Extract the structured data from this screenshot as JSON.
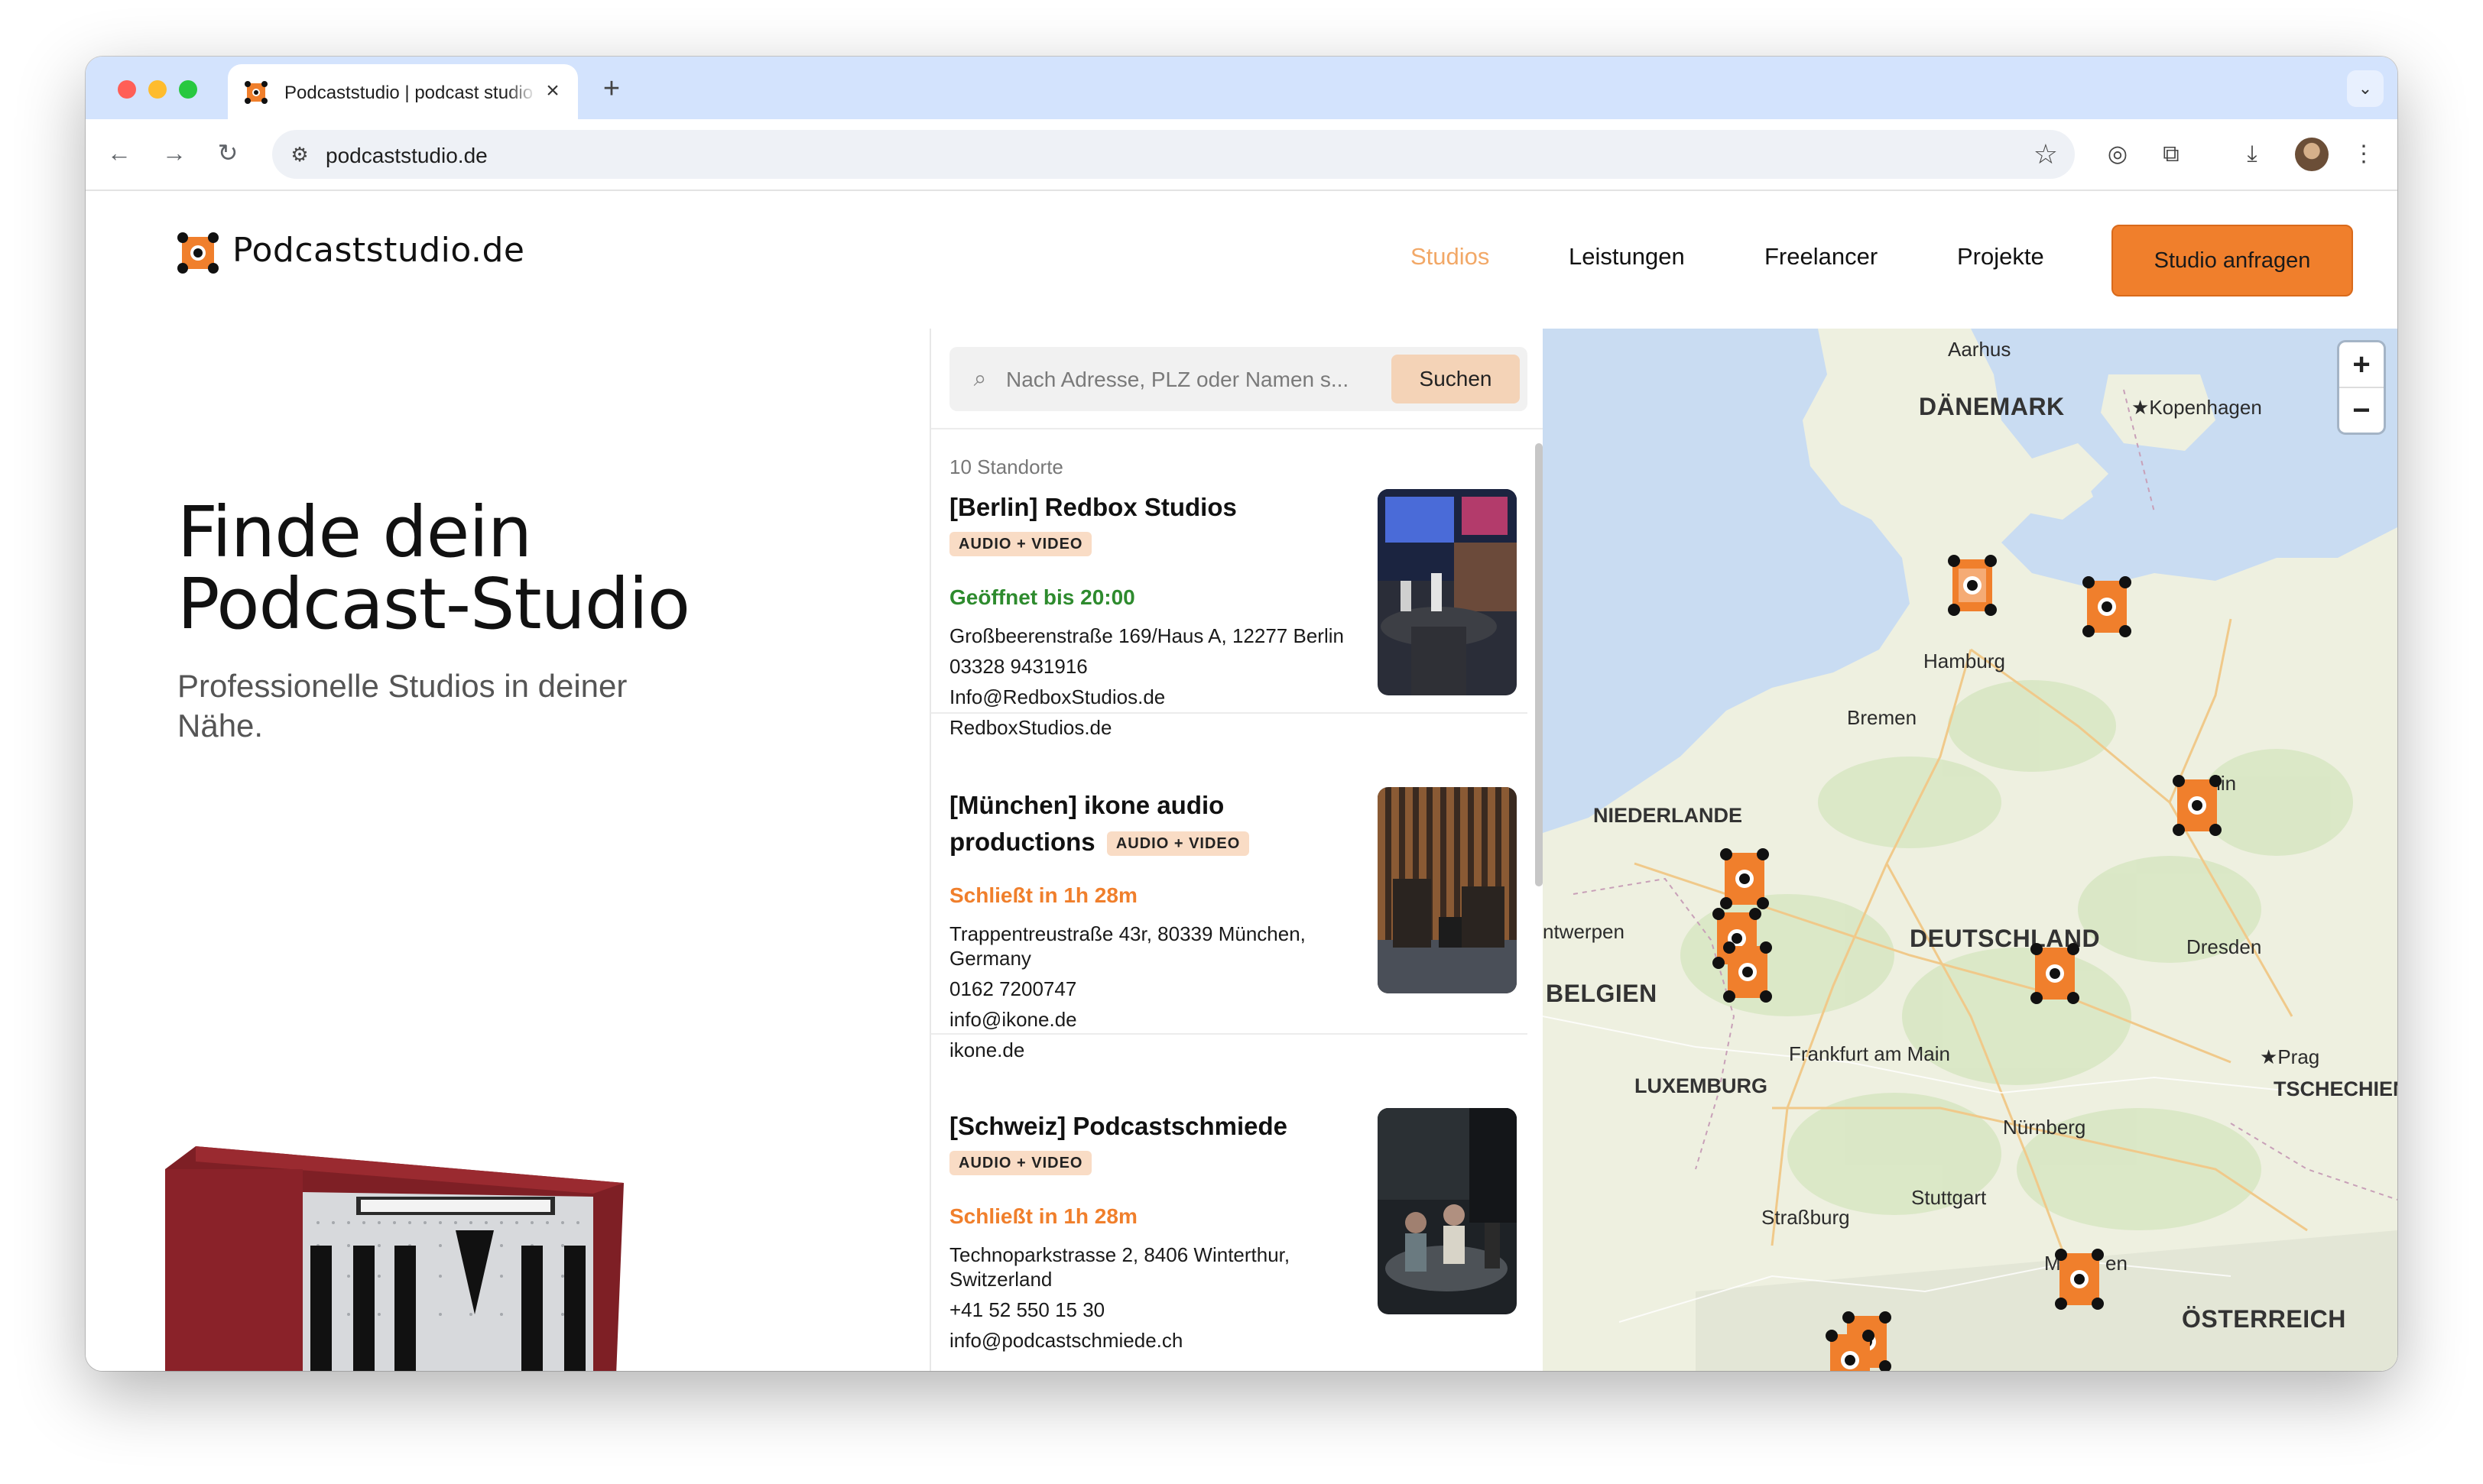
{
  "browser": {
    "tab_title": "Podcaststudio | podcast studio",
    "url": "podcaststudio.de"
  },
  "header": {
    "brand": "Podcaststudio.de",
    "nav": [
      {
        "label": "Studios",
        "active": true
      },
      {
        "label": "Leistungen"
      },
      {
        "label": "Freelancer"
      },
      {
        "label": "Projekte"
      }
    ],
    "cta": "Studio anfragen"
  },
  "hero": {
    "title_line1": "Finde dein",
    "title_line2": "Podcast-Studio",
    "subtitle": "Professionelle Studios in deiner Nähe."
  },
  "search": {
    "placeholder": "Nach Adresse, PLZ oder Namen s...",
    "button": "Suchen"
  },
  "results": {
    "count": "10 Standorte",
    "studios": [
      {
        "name": "[Berlin] Redbox Studios",
        "badge": "AUDIO + VIDEO",
        "status": "Geöffnet bis 20:00",
        "address": "Großbeerenstraße 169/Haus A, 12277 Berlin",
        "phone": "03328 9431916",
        "email": "Info@RedboxStudios.de",
        "web": "RedboxStudios.de"
      },
      {
        "name": "[München] ikone audio productions",
        "badge": "AUDIO + VIDEO",
        "status": "Schließt in 1h 28m",
        "address": "Trappentreustraße 43r, 80339 München, Germany",
        "phone": "0162 7200747",
        "email": "info@ikone.de",
        "web": "ikone.de"
      },
      {
        "name": "[Schweiz] Podcastschmiede",
        "badge": "AUDIO + VIDEO",
        "status": "Schließt in 1h 28m",
        "address": "Technoparkstrasse 2, 8406 Winterthur, Switzerland",
        "phone": "+41 52 550 15 30",
        "email": "info@podcastschmiede.ch"
      }
    ]
  },
  "map": {
    "zoom_in": "+",
    "zoom_out": "−",
    "labels": {
      "aarhus": "Aarhus",
      "daenemark": "DÄNEMARK",
      "kopenhagen": "Kopenhagen",
      "hamburg": "Hamburg",
      "bremen": "Bremen",
      "berlin": "erlin",
      "niederlande": "NIEDERLANDE",
      "antwerpen": "ntwerpen",
      "belgien": "BELGIEN",
      "deutschland": "DEUTSCHLAND",
      "dresden": "Dresden",
      "frankfurt": "Frankfurt am Main",
      "prag": "Prag",
      "luxemburg": "LUXEMBURG",
      "tschechien": "TSCHECHIEN",
      "nuernberg": "Nürnberg",
      "stuttgart": "Stuttgart",
      "strassburg": "Straßburg",
      "muenchen_a": "M",
      "muenchen_b": "en",
      "oesterreich": "ÖSTERREICH"
    }
  },
  "colors": {
    "brand_orange": "#f07f2c",
    "badge_bg": "#f9dcc5",
    "open_green": "#2e8b2e",
    "nav_active": "#f2a867",
    "map_water": "#c9dcf2",
    "map_land": "#eef0e0"
  }
}
